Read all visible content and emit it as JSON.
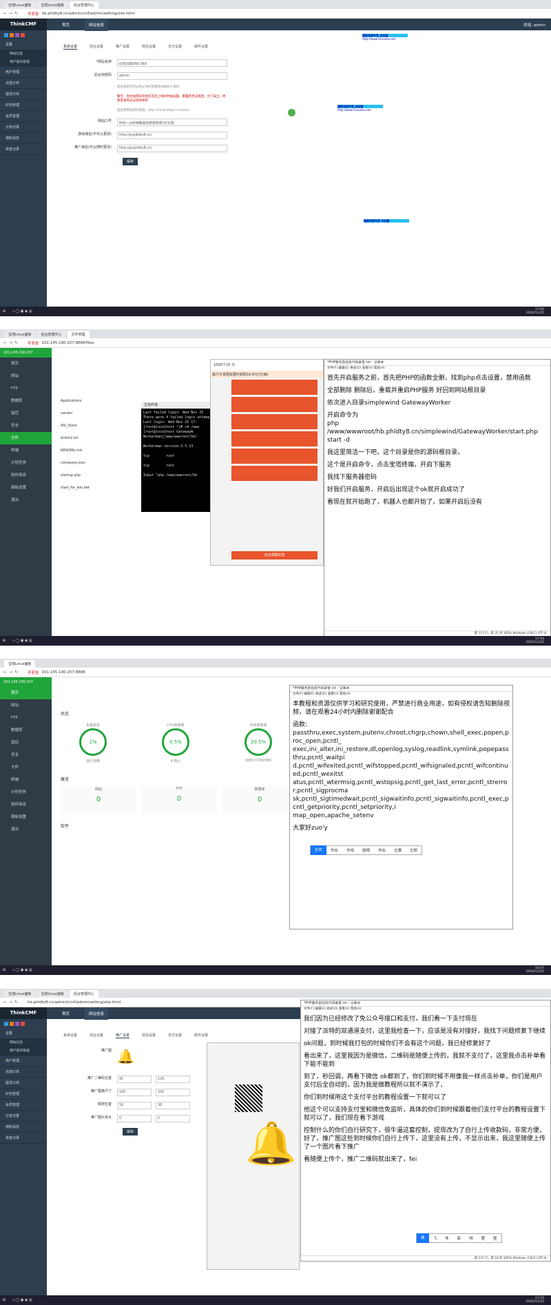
{
  "shot1": {
    "tabs": [
      "宝塔Linux面板",
      "宝塔Linux面板",
      "后台管理中心"
    ],
    "addr": "hb.phldty8.cn/admin/cmf/admin/setting/site.html",
    "addr_warn": "不安全",
    "brand": "ThinkCMF",
    "top_menu": [
      "首页",
      "网站信息"
    ],
    "user": "欢迎, admin",
    "side_items": [
      "设置",
      "网站信息",
      "用户操作管理",
      "用户管理",
      "充值订单",
      "提现订单",
      "红包管理",
      "会员管理",
      "分享记录",
      "通知消息",
      "资金记录"
    ],
    "page_tabs": [
      "系统设置",
      "前台设置",
      "推广设置",
      "短信设置",
      "支付设置",
      "邮件设置"
    ],
    "rows": [
      {
        "label": "*网站名称",
        "value": "红包扫雷SNS-369"
      },
      {
        "label": "后台加密码",
        "value": "admin"
      }
    ],
    "notes": [
      "后台加密码可以防止你的管理地址被他人得知",
      "警告：后台加密码仅会在首次上线的时候设置，重置后无法找回，为了安全，修改后请务必记住并保存",
      "后台使用加密码登陆：http://hb.phldty8.cn/admin"
    ],
    "rows2": [
      {
        "label": "网站口号",
        "value": "时间一分秒钟都是免费提现吧(支付宝)"
      },
      {
        "label": "游戏域名(不可以更改)",
        "value": "http://ecglbdty8.cn/"
      },
      {
        "label": "推广域名(可以随时更改)",
        "value": "http://pcphldty8.cn/"
      }
    ],
    "save": "保存",
    "ad_text": "搜索资源专家  本站整",
    "ad_url": "http://www.51xuela.com",
    "clock_time": "17:00",
    "clock_date": "2020/11/25"
  },
  "shot2": {
    "tabs": [
      "宝塔Linux面板",
      "后台管理中心",
      "文件管理"
    ],
    "addr": "101.145.190.207:8888/files",
    "addr_warn": "不安全",
    "ip": "101.145.190.207",
    "side": [
      "首页",
      "网站",
      "FTP",
      "数据库",
      "监控",
      "安全",
      "文件",
      "终端",
      "计划任务",
      "软件商店",
      "面板设置",
      "退出"
    ],
    "files": [
      "Applications",
      "vendor",
      "ASl_Store",
      "dirlist2.txt",
      "READMe.md",
      "composer.json",
      "startup.php",
      "start_for_win.bat"
    ],
    "terminal": "Last failed login: Wed Nov 25\nThere were 4 failed login attempts\nLast login: Wed Nov 25 17:\n[root@localhost ~]# cd /www\n[root@localhost GatewayW\nWorkerman]/www/wwwroot/hb/\n\nWorkerman version:3.5.13\n\ntcp        root\n\ntcp        root\n\nInput \"php /www/wwwroot/hb",
    "term_title": "宝塔终端",
    "phone_title": "1000个/次 元",
    "phone_msg": "客户分享朋友圈可获取18.8元/分(每)",
    "packet_label": "点击领取红包",
    "notepad_title": "*PHP服务启动及代码录音.txt - 记事本",
    "notepad_menu": "文件(F)  编辑(E)  格式(O)  查看(V)  帮助(H)",
    "notepad_lines": [
      "首先开启服务之前，首先把PHP的函数全删，找到php点击设置，禁用函数",
      "全部删除 删除后，重载并重启PHP服务 好回到网站根目录",
      "依次进入目录simplewind  GatewayWorker",
      "开启命令为\nphp\n/www/wwwroot/hb.phldty8.cn/simplewind/GatewayWorker/start.php\nstart -d",
      "我这里简洁一下吧，这个目录是你的源码根目录，",
      "这个是开启命令，点击宝塔终端，开启下服务",
      "我找下服务器密码",
      "好我们开启服务，开启后出现这个ok就开启成功了",
      "看现在就开始跑了，机器人也都开始了，如果开启后没有"
    ],
    "notepad_status": "第 113 行，第 35 列    100%    Windows (CRLF)    UTF-8",
    "clock_time": "17:04",
    "clock_date": "2020/11/25"
  },
  "shot3": {
    "addr": "101.145.190.207:8888",
    "ip": "101.145.190.207",
    "side": [
      "首页",
      "网站",
      "FTP",
      "数据库",
      "监控",
      "安全",
      "文件",
      "终端",
      "计划任务",
      "软件商店",
      "面板设置",
      "退出"
    ],
    "section_status": "状态",
    "gauges": [
      {
        "label": "负载状态",
        "value": "1%",
        "sub": "运行流畅"
      },
      {
        "label": "CPU使用率",
        "value": "0.5%",
        "sub": "4 核心"
      },
      {
        "label": "内存使用率",
        "value": "20.5%",
        "sub": "3885/3789(MB)"
      }
    ],
    "section_overview": "概览",
    "stats": [
      {
        "label": "网站",
        "value": "0"
      },
      {
        "label": "FTP",
        "value": "0"
      },
      {
        "label": "数据库",
        "value": "0"
      }
    ],
    "section_software": "软件",
    "notepad_title": "*PHP服务启动及代码录音.txt - 记事本",
    "notepad_lines": [
      "本教程和资源仅供学习和研究使用，严禁进行商业用途，如有侵权请告知删除视频，请在观看24小时内删除谢谢配合",
      "函数:\npassthru,exec,system,putenv,chroot,chgrp,chown,shell_exec,popen,proc_open,pcntl_\nexec,ini_alter,ini_restore,dl,openlog,syslog,readlink,symlink,popepassthru,pcntl_waitpi\nd,pcntl_wifexited,pcntl_wifstopped,pcntl_wifsignaled,pcntl_wifcontinued,pcntl_wexitst\natus,pcntl_wtermsig,pcntl_wstopsig,pcntl_get_last_error,pcntl_strerror,pcntl_sigprocma\nsk,pcntl_sigtimedwait,pcntl_sigwaitinfo,pcntl_sigwaitinfo,pcntl_exec,pcntl_getpriority,pcntl_setpriority,i\nmap_open,apache_setenv",
      "大家好zuo'y"
    ],
    "ime": [
      "左右",
      "作业",
      "作用",
      "座椅",
      "作业",
      "左翼",
      "左耶"
    ],
    "clock_time": "16:47",
    "clock_date": "2020/11/25"
  },
  "shot4": {
    "tabs": [
      "宝塔Linux面板",
      "宝塔Linux面板",
      "后台管理中心"
    ],
    "addr": "hb.phldty8.cn/admin/cmf/admin/setting/site.html",
    "brand": "ThinkCMF",
    "top_menu": [
      "首页",
      "网站信息"
    ],
    "side_items": [
      "设置",
      "网站信息",
      "用户操作管理",
      "用户管理",
      "充值订单",
      "提现订单",
      "红包管理",
      "会员管理",
      "分享记录",
      "通知消息",
      "资金记录"
    ],
    "page_tabs": [
      "系统设置",
      "前台设置",
      "推广设置",
      "短信设置",
      "支付设置",
      "邮件设置"
    ],
    "promo_label": "推广图",
    "rows": [
      {
        "label": "推广二维码位置",
        "v1": "95",
        "v2": "129"
      },
      {
        "label": "推广图像尺寸",
        "v1": "100",
        "v2": "200"
      },
      {
        "label": "昵称位置",
        "v1": "18",
        "v2": "38"
      },
      {
        "label": "推广图片放大",
        "v1": "0",
        "v2": "0"
      }
    ],
    "save": "保存",
    "notepad_title": "*PHP服务启动及代码录音.txt - 记事本",
    "notepad_lines": [
      "我们因为已经修改了免公众号接口和支付，我们看一下支付现在",
      "对接了派特的双通道支付，这里我检查一下，应该是没有对接好，我找下问题修复下继续",
      "ok问题，到时候我打包的时候你们不会有这个问题，我已经修复好了",
      "看出来了，这里我因为是微信，二维码是随便上传的，我就不支付了，这里我点击补单看下能不能到",
      "到了，秒回调，再看下微信 ok都到了，你们到时候不用像我一样点击补单，你们是用户支付后全自动的，因为我是做教程所以就不演示了，",
      "你们到时候用这个支付平台的教程设置一下就可以了",
      "他这个可以支持支付宝和微信免监听，具体的你们到时候跟着他们支付平台的教程设置下就可以了，我们现在看下游戏",
      "控制什么的你们自行研究下，很牛逼这套控制，提现改为了自行上传收款码，非常方便，好了，推广图这些到时候你们自行上传下，这里没有上传，不显示出来，我这里随便上传了一个图片看下推广",
      "看随便上传个，推广二维码就出来了，fei"
    ],
    "ime": [
      "费",
      "飞",
      "非",
      "菲",
      "啡",
      "肥",
      "匪"
    ],
    "notepad_status": "第 137 行，第 18 列    100%    Windows (CRLF)    UTF-8",
    "clock_time": "17:25",
    "clock_date": "2020/11/25"
  },
  "colors": {
    "navy": "#2c3e50",
    "bt_green": "#20a53a",
    "red": "#e8542c"
  }
}
